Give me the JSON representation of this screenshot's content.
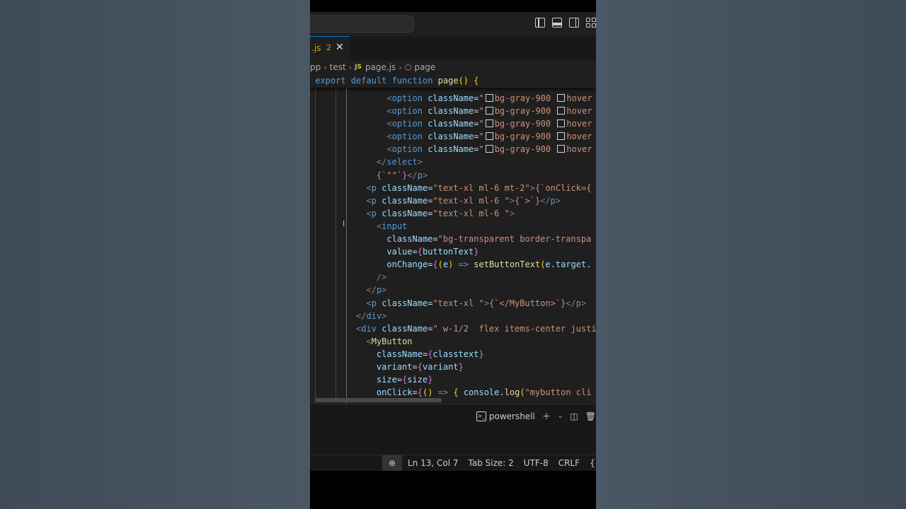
{
  "tab": {
    "name": ".js",
    "problem_count": "2",
    "close_glyph": "✕"
  },
  "breadcrumb": {
    "root": "pp",
    "folder": "test",
    "file_badge": "JS",
    "file": "page.js",
    "symbol": "page"
  },
  "sticky": {
    "export": "export",
    "default": "default",
    "function": "function",
    "name": "page",
    "rest": "() {"
  },
  "code": {
    "option": "option",
    "className": "className",
    "bg900": "bg-gray-900",
    "hover": "hover",
    "select": "select",
    "emptyStr": "\"\"",
    "p": "p",
    "cls_mt2": "\"text-xl ml-6 mt-2\"",
    "onClickTpl": "`onClick={",
    "cls_ml6s": "\"text-xl ml-6 \"",
    "gtTpl": "`>`",
    "input": "input",
    "cls_bgtr": "\"bg-transparent border-transpa",
    "value": "value",
    "buttonText": "buttonText",
    "onChange": "onChange",
    "e": "e",
    "setButtonText": "setButtonText",
    "eTarget": "e.target.",
    "cls_xl": "\"text-xl \"",
    "myButtonClose": "`</MyButton>`",
    "div": "div",
    "cls_w12": "\" w-1/2  flex items-center justi",
    "MyButton": "MyButton",
    "classtext": "classtext",
    "variant": "variant",
    "size": "size",
    "onClick": "onClick",
    "console": "console",
    "log": "log",
    "mybuttonStr": "\"mybutton cli"
  },
  "panel": {
    "shell": "powershell",
    "ps_glyph": ">_"
  },
  "status": {
    "position": "Ln 13, Col 7",
    "tab_size": "Tab Size: 2",
    "encoding": "UTF-8",
    "eol": "CRLF",
    "language": "{ } JavaS"
  },
  "colors": {
    "editor_bg": "#1f1f1f",
    "accent": "#0078d4",
    "warning": "#cca700"
  }
}
